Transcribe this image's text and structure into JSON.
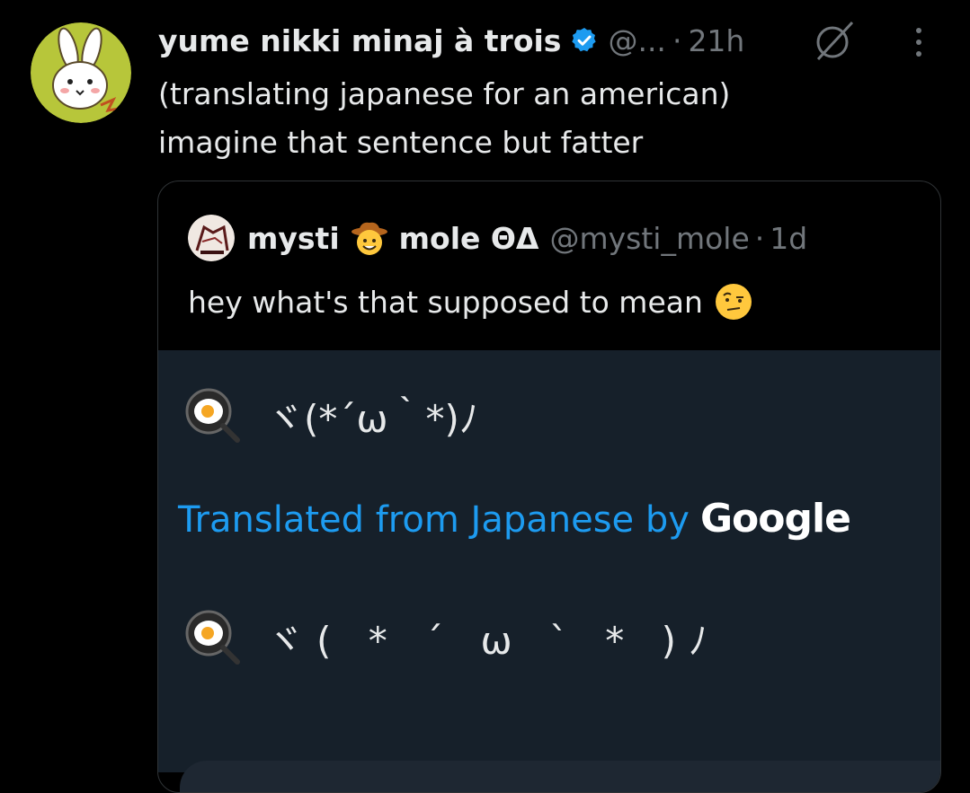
{
  "tweet": {
    "author_name": "yume nikki minaj à trois",
    "handle": "@...",
    "separator": "·",
    "time": "21h",
    "text_line1": "(translating japanese for an american)",
    "text_line2": "imagine that sentence but fatter"
  },
  "quote": {
    "name_part1": "mysti",
    "name_emoji": "cowboy-face-icon",
    "name_part2": "mole ΘΔ",
    "handle": "@mysti_mole",
    "separator": "·",
    "time": "1d",
    "text": "hey what's that supposed to mean",
    "text_emoji": "raised-eyebrow-face-icon",
    "original_kaomoji": "ヾ(*´ω｀*)ﾉ",
    "translation_label": "Translated from Japanese by",
    "translation_provider": "Google",
    "translated_kaomoji": "ヾ( * ´ ω ` * )ﾉ",
    "kaomoji_emoji": "fried-egg-pan-icon"
  },
  "colors": {
    "background": "#000000",
    "text": "#e7e9ea",
    "muted": "#71767b",
    "accent": "#1d9bf0",
    "panel": "#16202a"
  }
}
